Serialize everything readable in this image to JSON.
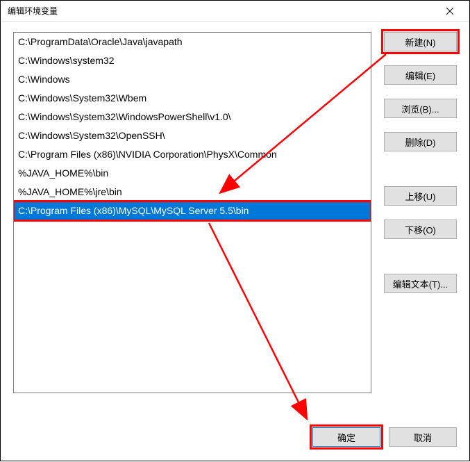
{
  "dialog": {
    "title": "编辑环境变量"
  },
  "list": {
    "items": [
      "C:\\ProgramData\\Oracle\\Java\\javapath",
      "C:\\Windows\\system32",
      "C:\\Windows",
      "C:\\Windows\\System32\\Wbem",
      "C:\\Windows\\System32\\WindowsPowerShell\\v1.0\\",
      "C:\\Windows\\System32\\OpenSSH\\",
      "C:\\Program Files (x86)\\NVIDIA Corporation\\PhysX\\Common",
      "%JAVA_HOME%\\bin",
      "%JAVA_HOME%\\jre\\bin",
      "C:\\Program Files (x86)\\MySQL\\MySQL Server 5.5\\bin"
    ],
    "selected_index": 9
  },
  "buttons": {
    "new": "新建(N)",
    "edit": "编辑(E)",
    "browse": "浏览(B)...",
    "delete": "删除(D)",
    "move_up": "上移(U)",
    "move_down": "下移(O)",
    "edit_text": "编辑文本(T)...",
    "ok": "确定",
    "cancel": "取消"
  },
  "annotations": {
    "highlighted_buttons": [
      "new",
      "ok"
    ],
    "highlighted_item_index": 9,
    "arrows": true,
    "accent_color": "#ff0000"
  }
}
